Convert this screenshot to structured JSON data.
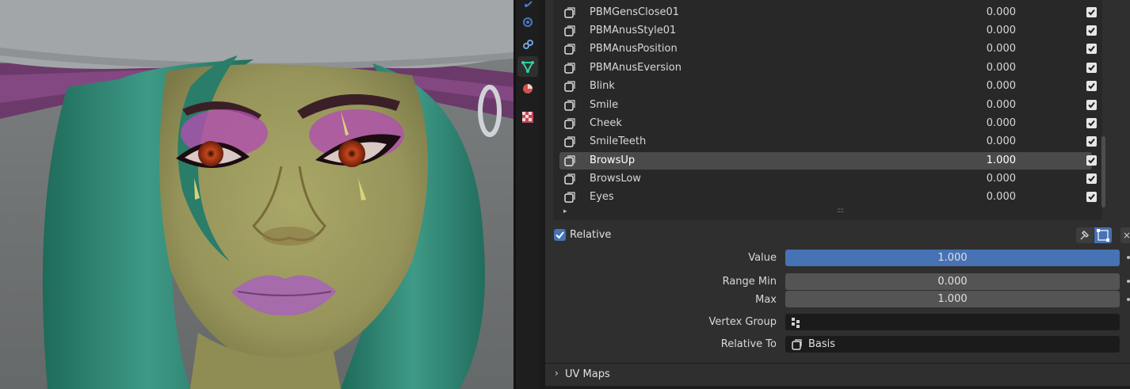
{
  "viewport": {
    "subject": "3d-character-head"
  },
  "properties_tabs": [
    {
      "icon": "physics-icon",
      "color": "#4b79c2"
    },
    {
      "icon": "constraints-icon",
      "color": "#6fa0e0"
    },
    {
      "icon": "object-data-icon",
      "color": "#2fd1a7",
      "active": true
    },
    {
      "icon": "material-icon",
      "color": "#d1534d"
    },
    {
      "icon": "texture-icon",
      "color": "#c2495a"
    }
  ],
  "shape_keys": [
    {
      "name": "PBMGensClose01",
      "value": "0.000",
      "enabled": true
    },
    {
      "name": "PBMAnusStyle01",
      "value": "0.000",
      "enabled": true
    },
    {
      "name": "PBMAnusPosition",
      "value": "0.000",
      "enabled": true
    },
    {
      "name": "PBMAnusEversion",
      "value": "0.000",
      "enabled": true
    },
    {
      "name": "Blink",
      "value": "0.000",
      "enabled": true
    },
    {
      "name": "Smile",
      "value": "0.000",
      "enabled": true
    },
    {
      "name": "Cheek",
      "value": "0.000",
      "enabled": true
    },
    {
      "name": "SmileTeeth",
      "value": "0.000",
      "enabled": true
    },
    {
      "name": "BrowsUp",
      "value": "1.000",
      "enabled": true,
      "selected": true
    },
    {
      "name": "BrowsLow",
      "value": "0.000",
      "enabled": true
    },
    {
      "name": "Eyes",
      "value": "0.000",
      "enabled": true
    }
  ],
  "list_controls": {
    "expand_glyph": "▸",
    "grip": "::::"
  },
  "relative": {
    "label": "Relative",
    "checked": true
  },
  "header_buttons": {
    "clear": "×"
  },
  "properties": {
    "value": {
      "label": "Value",
      "value": "1.000",
      "fill": 1.0
    },
    "range_min": {
      "label": "Range Min",
      "value": "0.000"
    },
    "max": {
      "label": "Max",
      "value": "1.000"
    },
    "vertex_group": {
      "label": "Vertex Group",
      "value": ""
    },
    "relative_to": {
      "label": "Relative To",
      "value": "Basis"
    }
  },
  "uv_maps": {
    "label": "UV Maps",
    "chevron": "›"
  },
  "colors": {
    "accent": "#4772b3",
    "panel": "#2f2f2f",
    "list_bg": "#282828"
  }
}
